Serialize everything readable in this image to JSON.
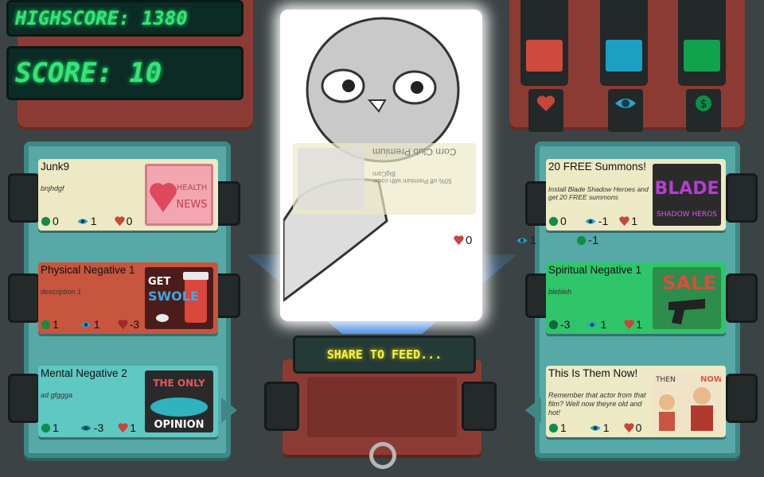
{
  "hud": {
    "highscore_text": "HIGHSCORE: 1380",
    "score_text": "SCORE: 10"
  },
  "meters": [
    {
      "name": "heart",
      "color": "#cf4a3e"
    },
    {
      "name": "eye",
      "color": "#1ba0c4"
    },
    {
      "name": "money",
      "color": "#11a24e"
    }
  ],
  "left_cards": [
    {
      "title": "Junk9",
      "description": "bnjhdgf",
      "money": "0",
      "eye": "1",
      "heart": "0",
      "bg": "#ece9c4",
      "art_text": [
        "HEALTH",
        "NEWS"
      ]
    },
    {
      "title": "Physical Negative 1",
      "description": "description 1",
      "money": "1",
      "eye": "1",
      "heart": "-3",
      "bg": "#c8553e",
      "art_text": [
        "GET",
        "SWOLE"
      ]
    },
    {
      "title": "Mental Negative 2",
      "description": "ad gfggga",
      "money": "1",
      "eye": "-3",
      "heart": "1",
      "bg": "#5fc8c3",
      "art_text": [
        "THE ONLY",
        "OPINION"
      ]
    }
  ],
  "right_cards": [
    {
      "title": "20 FREE Summons!",
      "description": "Install Blade Shadow Heroes and get 20 FREE summons",
      "money": "0",
      "eye": "-1",
      "heart": "1",
      "bg": "#ece9c4",
      "art_text": [
        "BLADE",
        "SHADOW HEROS"
      ]
    },
    {
      "title": "Spiritual Negative 1",
      "description": "blebleh",
      "money": "-3",
      "eye": "1",
      "heart": "1",
      "bg": "#2fc56a",
      "art_text": [
        "SALE"
      ]
    },
    {
      "title": "This Is Them Now!",
      "description": "Remember that actor from that film? Well now theyre old and hot!",
      "money": "1",
      "eye": "1",
      "heart": "0",
      "bg": "#ece9c4",
      "art_text": [
        "THEN",
        "NOW"
      ]
    }
  ],
  "center": {
    "ghost_card_title": "Corn Club Premium",
    "ghost_card_desc": "50% off Premium with code: BigCorn",
    "ghost_heart": "0",
    "ghost_eye": "1",
    "ghost_money": "-1",
    "share_button": "SHARE TO FEED..."
  }
}
